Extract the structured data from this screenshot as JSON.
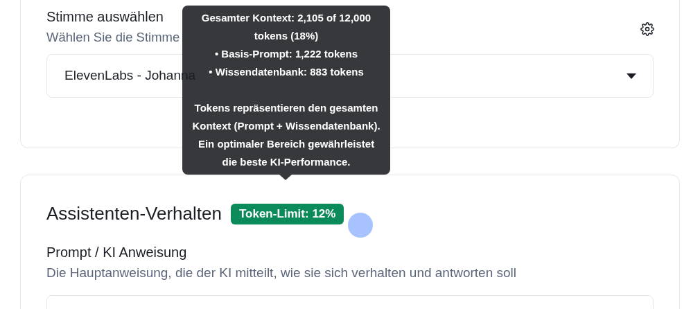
{
  "voice_card": {
    "title": "Stimme auswählen",
    "description": "Wählen Sie die Stimme",
    "select": {
      "value": "ElevenLabs - Johanna"
    }
  },
  "behavior_card": {
    "title": "Assistenten-Verhalten",
    "badge": {
      "label": "Token-Limit: 12%",
      "color": "#0b8a5a"
    },
    "field": {
      "label": "Prompt / KI Anweisung",
      "description": "Die Hauptanweisung, die der KI mitteilt, wie sie sich verhalten und antworten soll"
    }
  },
  "tooltip": {
    "lines": [
      "Gesamter Kontext: 2,105 of 12,000 tokens (18%)",
      "• Basis-Prompt: 1,222 tokens",
      "• Wissendatenbank: 883 tokens"
    ],
    "note": "Tokens repräsentieren den gesamten Kontext (Prompt + Wissendatenbank). Ein optimaler Bereich gewährleistet die beste KI-Performance."
  }
}
